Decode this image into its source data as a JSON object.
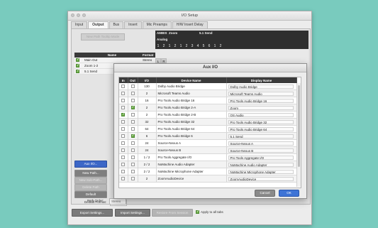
{
  "window": {
    "title": "I/O Setup"
  },
  "tabs": [
    {
      "label": "Input"
    },
    {
      "label": "Output"
    },
    {
      "label": "Bus"
    },
    {
      "label": "Insert"
    },
    {
      "label": "Mic Preamps"
    },
    {
      "label": "H/W Insert Delay"
    }
  ],
  "output": {
    "new_path_top": "New Path Tooltip Mode",
    "group_headers": {
      "ambis": "AMBIS",
      "zoom": "Zoom",
      "five_one": "5.1 Send",
      "analog": "Analog"
    },
    "col_numbers": [
      "1",
      "2",
      "1",
      "2",
      "1",
      "2",
      "3",
      "4",
      "5",
      "6",
      "1",
      "2"
    ],
    "headers": {
      "name": "Name",
      "format": "Format"
    },
    "rows": [
      {
        "checked": true,
        "name": "Main Out",
        "format": "Stereo",
        "assign": [
          "L",
          "R"
        ]
      },
      {
        "checked": true,
        "name": "Zoom 1-2",
        "format": "Stereo",
        "assign": [
          "L",
          "R"
        ]
      },
      {
        "checked": true,
        "name": "5.1 Send",
        "format": "5.1",
        "assign": [
          "L",
          "C",
          "R",
          "Ls",
          "Rs",
          "LFE"
        ]
      }
    ]
  },
  "side_buttons": {
    "aux": "Aux I/O...",
    "new_path": "New Path...",
    "subpath": "New Sub-Path...",
    "delete": "Delete Path",
    "default": "Default"
  },
  "default_format": {
    "label": "Default Format:",
    "value": "Stereo"
  },
  "path_order": {
    "label": "Path Order:",
    "value": "Stereo"
  },
  "bottom": {
    "export": "Export Settings...",
    "import": "Import Settings...",
    "restore": "Restore From Session",
    "apply_all": "Apply to all tabs",
    "apply_all_checked": true
  },
  "dialog": {
    "title": "Aux I/O",
    "headers": {
      "in": "In",
      "out": "Out",
      "io": "I/O",
      "device": "Device Name",
      "display": "Display Name"
    },
    "rows": [
      {
        "in": false,
        "out": false,
        "io": "130",
        "device": "Dolby Audio Bridge",
        "display": "Dolby Audio Bridge"
      },
      {
        "in": false,
        "out": false,
        "io": "2",
        "device": "Microsoft Teams Audio",
        "display": "Microsoft Teams Audio"
      },
      {
        "in": false,
        "out": false,
        "io": "16",
        "device": "Pro Tools Audio Bridge 16",
        "display": "Pro Tools Audio Bridge 16"
      },
      {
        "in": false,
        "out": true,
        "io": "2",
        "device": "Pro Tools Audio Bridge 2-A",
        "display": "Zoom"
      },
      {
        "in": true,
        "out": false,
        "io": "2",
        "device": "Pro Tools Audio Bridge 2-B",
        "display": "OS Audio"
      },
      {
        "in": false,
        "out": false,
        "io": "32",
        "device": "Pro Tools Audio Bridge 32",
        "display": "Pro Tools Audio Bridge 32"
      },
      {
        "in": false,
        "out": false,
        "io": "64",
        "device": "Pro Tools Audio Bridge 64",
        "display": "Pro Tools Audio Bridge 64"
      },
      {
        "in": false,
        "out": true,
        "io": "6",
        "device": "Pro Tools Audio Bridge 6",
        "display": "5.1 Send"
      },
      {
        "in": false,
        "out": false,
        "io": "24",
        "device": "Source-Nexus A",
        "display": "Source-Nexus A"
      },
      {
        "in": false,
        "out": false,
        "io": "24",
        "device": "Source-Nexus B",
        "display": "Source-Nexus B"
      },
      {
        "in": false,
        "out": false,
        "io": "1 / 2",
        "device": "Pro Tools Aggregate I/O",
        "display": "Pro Tools Aggregate I/O"
      },
      {
        "in": false,
        "out": false,
        "io": "2 / 2",
        "device": "NoMachine Audio Adapter",
        "display": "NoMachine Audio Adapter"
      },
      {
        "in": false,
        "out": false,
        "io": "2 / 2",
        "device": "NoMachine Microphone Adapter",
        "display": "NoMachine Microphone Adapter"
      },
      {
        "in": false,
        "out": false,
        "io": "2",
        "device": "ZoomAudioDevice",
        "display": "ZoomAudioDevice"
      }
    ],
    "cancel": "Cancel",
    "ok": "OK"
  },
  "colors": {
    "background": "#79cbbe",
    "accent": "#3e74d6",
    "check": "#6fae4a"
  }
}
